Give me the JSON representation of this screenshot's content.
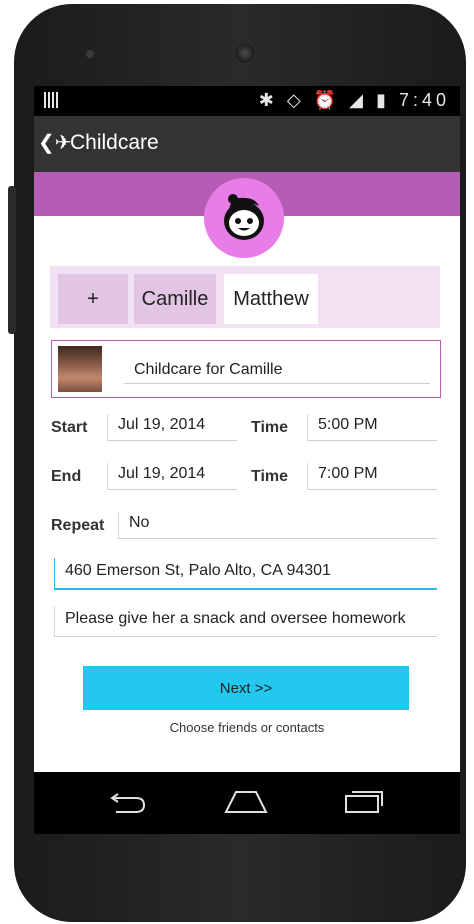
{
  "status_bar": {
    "time": "7:40",
    "icons": [
      "notification-bars-icon",
      "bluetooth-icon",
      "rotate-icon",
      "alarm-icon",
      "lte-signal-icon",
      "battery-icon"
    ]
  },
  "action_bar": {
    "title": "Childcare",
    "back_glyph": "❮✈"
  },
  "tabs": [
    {
      "label": "+"
    },
    {
      "label": "Camille"
    },
    {
      "label": "Matthew"
    }
  ],
  "event": {
    "title": "Childcare for Camille"
  },
  "start": {
    "label": "Start",
    "date": "Jul 19, 2014",
    "time_label": "Time",
    "time": "5:00 PM"
  },
  "end": {
    "label": "End",
    "date": "Jul 19, 2014",
    "time_label": "Time",
    "time": "7:00 PM"
  },
  "repeat": {
    "label": "Repeat",
    "value": "No"
  },
  "address": {
    "value": "460 Emerson St, Palo Alto, CA 94301"
  },
  "notes": {
    "value": "Please give her a snack and oversee homework"
  },
  "next_button": {
    "label": "Next >>"
  },
  "hint": {
    "text": "Choose friends or contacts"
  },
  "colors": {
    "header": "#b55cb5",
    "avatar": "#e87de8",
    "tabs_bg": "#f2e1f2",
    "button": "#22c8ee",
    "action_bar": "#333333"
  }
}
